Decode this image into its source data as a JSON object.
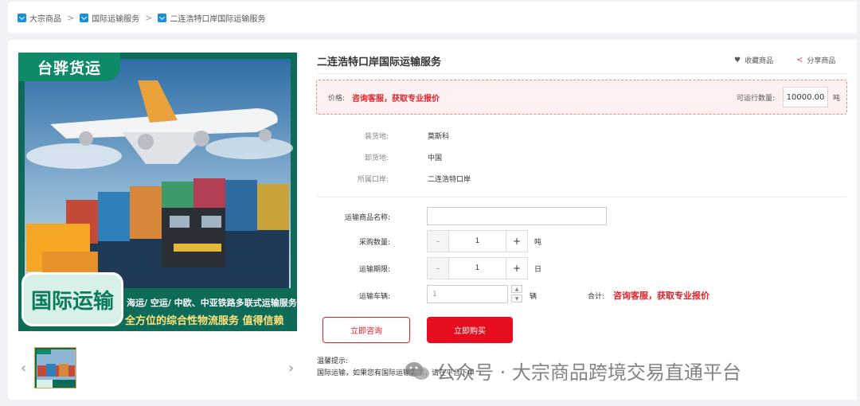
{
  "breadcrumb": [
    "大宗商品",
    "国际运输服务",
    "二连浩特口岸国际运输服务"
  ],
  "product": {
    "title": "二连浩特口岸国际运输服务",
    "favorite": "收藏商品",
    "share": "分享商品"
  },
  "image": {
    "brand": "台骅货运",
    "badge": "国际运输",
    "slogan1": "海运/ 空运/ 中欧、中亚铁路多联式运输服务",
    "slogan2": "全方位的综合性物流服务 值得信赖"
  },
  "price": {
    "label": "价格:",
    "value": "咨询客服，获取专业报价",
    "capacity_label": "可运行数量:",
    "capacity_value": "10000.00",
    "capacity_unit": "吨"
  },
  "details": [
    {
      "label": "装货地:",
      "value": "莫斯科"
    },
    {
      "label": "卸货地:",
      "value": "中国"
    },
    {
      "label": "所属口岸:",
      "value": "二连浩特口岸"
    }
  ],
  "form": {
    "goods_name_label": "运输商品名称:",
    "goods_name_value": "",
    "qty_label": "采购数量:",
    "qty_value": "1",
    "qty_unit": "吨",
    "period_label": "运输期限:",
    "period_value": "1",
    "period_unit": "日",
    "vehicle_label": "运输车辆:",
    "vehicle_value": "1",
    "vehicle_unit": "辆",
    "minus": "-",
    "plus": "+",
    "total_label": "合计:",
    "total_value": "咨询客服，获取专业报价"
  },
  "buttons": {
    "consult": "立即咨询",
    "buy": "立即购买"
  },
  "tips": {
    "title": "温馨提示:",
    "text": "国际运输，如果您有国际运输需求，请在平台下单"
  },
  "watermark": "公众号 · 大宗商品跨境交易直通平台",
  "colors": {
    "accent": "#e60d1e",
    "brand_green": "#0d6b57",
    "link_blue": "#1890d5"
  }
}
